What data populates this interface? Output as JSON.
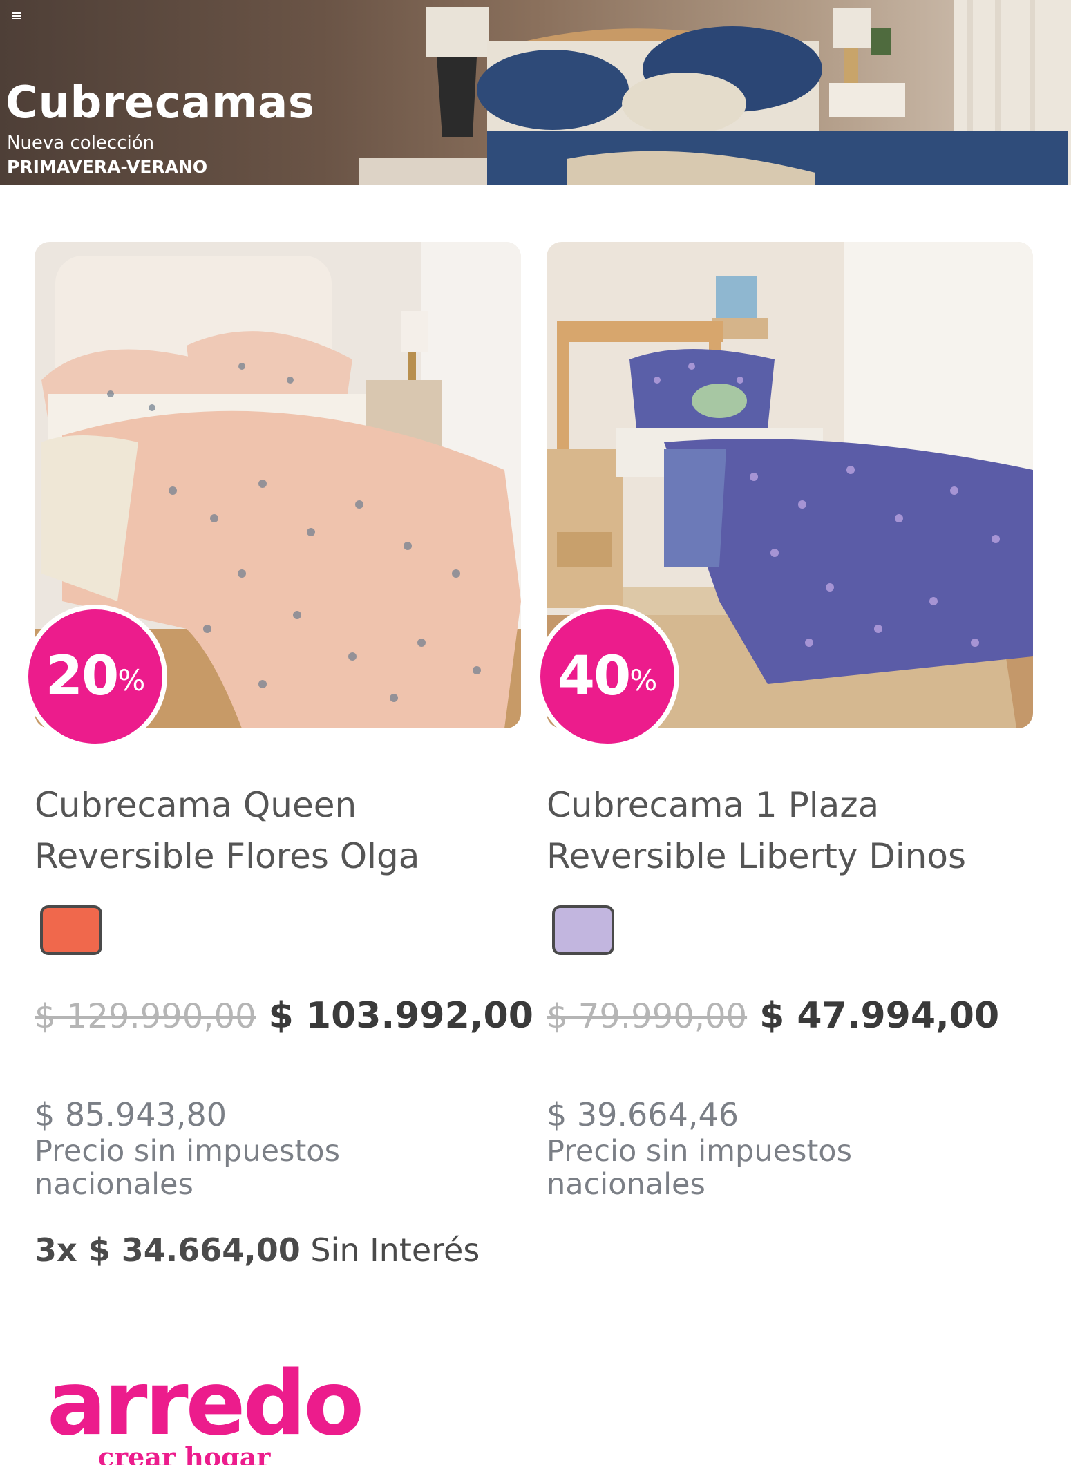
{
  "banner": {
    "title": "Cubrecamas",
    "subtitle": "Nueva colección",
    "season": "PRIMAVERA-VERANO"
  },
  "products": [
    {
      "name_line1": "Cubrecama Queen",
      "name_line2": "Reversible Flores Olga",
      "discount": "20",
      "discount_suffix": "%",
      "swatch_color": "#f0684c",
      "original_price": "$ 129.990,00",
      "sale_price": "$ 103.992,00",
      "net_price": "$ 85.943,80",
      "net_label": "Precio sin impuestos nacionales",
      "installments_amount": "3x $ 34.664,00",
      "installments_text": "Sin Interés"
    },
    {
      "name_line1": "Cubrecama 1 Plaza",
      "name_line2": "Reversible Liberty Dinos",
      "discount": "40",
      "discount_suffix": "%",
      "swatch_color": "#c2b6df",
      "original_price": "$ 79.990,00",
      "sale_price": "$ 47.994,00",
      "net_price": "$ 39.664,46",
      "net_label": "Precio sin impuestos nacionales"
    }
  ],
  "brand": {
    "name": "arredo",
    "tagline": "crear hogar",
    "accent": "#ec1c8c"
  }
}
